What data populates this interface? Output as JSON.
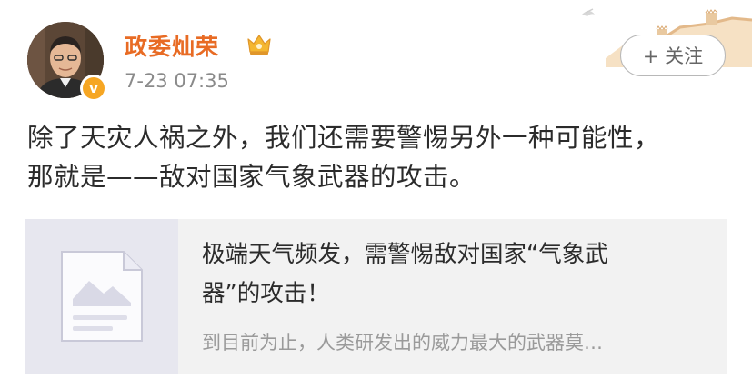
{
  "post": {
    "author": {
      "name": "政委灿荣",
      "avatar_icon": "user-avatar-photo",
      "verified_badge": "v",
      "badge_icon": "crown-icon"
    },
    "timestamp": "7-23 07:35",
    "follow_label": "+ 关注",
    "text_lines": [
      "除了天灾人祸之外，我们还需要警惕另外一种可能性，",
      "那就是——敌对国家气象武器的攻击。"
    ]
  },
  "link_card": {
    "thumbnail_icon": "article-document-icon",
    "title_lines": [
      "极端天气频发，需警惕敌对国家“气象武",
      "器”的攻击！"
    ],
    "summary": "到目前为止，人类研发出的威力最大的武器莫…"
  },
  "colors": {
    "username": "#e86b24",
    "verified": "#f6a623",
    "timestamp": "#8a8a8a",
    "card_background": "#f2f2f2",
    "summary_text": "#9a9a9a"
  }
}
